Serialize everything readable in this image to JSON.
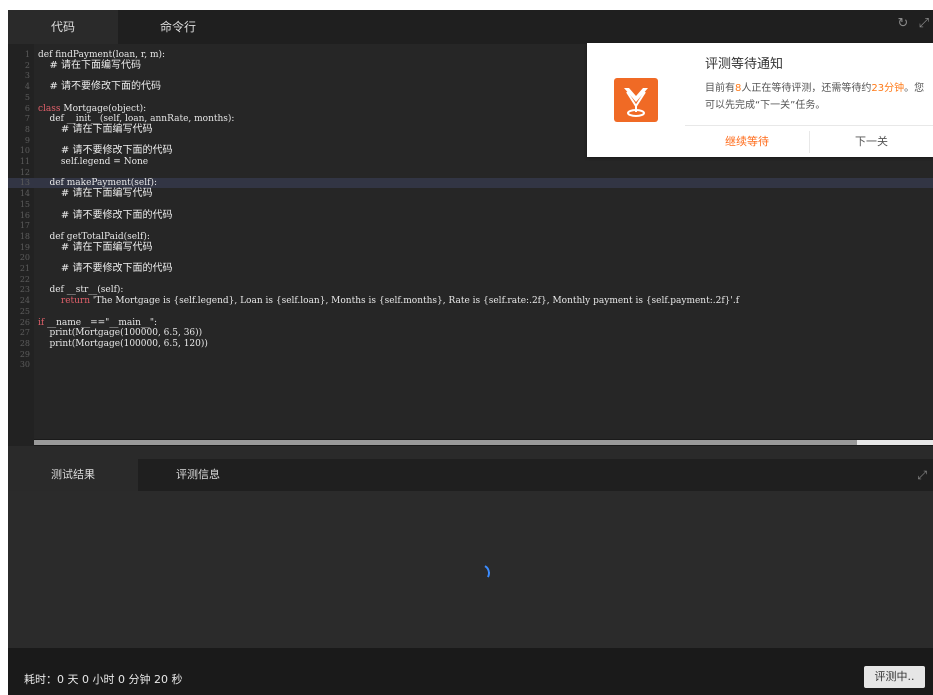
{
  "tabs": {
    "code": "代码",
    "command": "命令行"
  },
  "top_icons": {
    "reset": "↻",
    "expand": "⤢"
  },
  "code_lines": [
    {
      "num": "1",
      "parts": [
        {
          "t": "def findPayment(loan, r, m):"
        }
      ]
    },
    {
      "num": "2",
      "parts": [
        {
          "t": "    "
        },
        {
          "t": "# 请在下面编写代码",
          "c": "comment"
        }
      ]
    },
    {
      "num": "3",
      "parts": [
        {
          "t": ""
        }
      ]
    },
    {
      "num": "4",
      "parts": [
        {
          "t": "    "
        },
        {
          "t": "# 请不要修改下面的代码",
          "c": "comment"
        }
      ]
    },
    {
      "num": "5",
      "parts": [
        {
          "t": ""
        }
      ]
    },
    {
      "num": "6",
      "parts": [
        {
          "t": "class ",
          "c": "kw"
        },
        {
          "t": "Mortgage(object):"
        }
      ]
    },
    {
      "num": "7",
      "parts": [
        {
          "t": "    def __init__(self, loan, annRate, months):"
        }
      ]
    },
    {
      "num": "8",
      "parts": [
        {
          "t": "        "
        },
        {
          "t": "# 请在下面编写代码",
          "c": "comment"
        }
      ]
    },
    {
      "num": "9",
      "parts": [
        {
          "t": ""
        }
      ]
    },
    {
      "num": "10",
      "parts": [
        {
          "t": "        "
        },
        {
          "t": "# 请不要修改下面的代码",
          "c": "comment"
        }
      ]
    },
    {
      "num": "11",
      "parts": [
        {
          "t": "        self.legend = None"
        }
      ]
    },
    {
      "num": "12",
      "parts": [
        {
          "t": ""
        }
      ]
    },
    {
      "num": "13",
      "parts": [
        {
          "t": "    def makePayment(self):"
        }
      ]
    },
    {
      "num": "14",
      "parts": [
        {
          "t": "        "
        },
        {
          "t": "# 请在下面编写代码",
          "c": "comment"
        }
      ]
    },
    {
      "num": "15",
      "parts": [
        {
          "t": ""
        }
      ]
    },
    {
      "num": "16",
      "parts": [
        {
          "t": "        "
        },
        {
          "t": "# 请不要修改下面的代码",
          "c": "comment"
        }
      ]
    },
    {
      "num": "17",
      "parts": [
        {
          "t": ""
        }
      ]
    },
    {
      "num": "18",
      "parts": [
        {
          "t": "    def getTotalPaid(self):"
        }
      ]
    },
    {
      "num": "19",
      "parts": [
        {
          "t": "        "
        },
        {
          "t": "# 请在下面编写代码",
          "c": "comment"
        }
      ]
    },
    {
      "num": "20",
      "parts": [
        {
          "t": ""
        }
      ]
    },
    {
      "num": "21",
      "parts": [
        {
          "t": "        "
        },
        {
          "t": "# 请不要修改下面的代码",
          "c": "comment"
        }
      ]
    },
    {
      "num": "22",
      "parts": [
        {
          "t": ""
        }
      ]
    },
    {
      "num": "23",
      "parts": [
        {
          "t": "    def __str__(self):"
        }
      ]
    },
    {
      "num": "24",
      "parts": [
        {
          "t": "        "
        },
        {
          "t": "return ",
          "c": "kw"
        },
        {
          "t": "'The Mortgage is {self.legend}, Loan is {self.loan}, Months is {self.months}, Rate is {self.rate:.2f}, Monthly payment is {self.payment:.2f}'.f"
        }
      ]
    },
    {
      "num": "25",
      "parts": [
        {
          "t": ""
        }
      ]
    },
    {
      "num": "26",
      "parts": [
        {
          "t": "if ",
          "c": "kw"
        },
        {
          "t": "__name__==\"__main__\":"
        }
      ]
    },
    {
      "num": "27",
      "parts": [
        {
          "t": "    print(Mortgage(100000, 6.5, 36))"
        }
      ]
    },
    {
      "num": "28",
      "parts": [
        {
          "t": "    print(Mortgage(100000, 6.5, 120))"
        }
      ]
    },
    {
      "num": "29",
      "parts": [
        {
          "t": ""
        }
      ]
    },
    {
      "num": "30",
      "parts": [
        {
          "t": ""
        }
      ]
    }
  ],
  "highlighted_line": "13",
  "notice": {
    "title": "评测等待通知",
    "body_prefix": "目前有",
    "waiting_count": "8",
    "body_mid": "人正在等待评测，还需等待约",
    "wait_time": "23分钟",
    "body_suffix": "。您可以先完成“下一关”任务。",
    "continue_label": "继续等待",
    "next_label": "下一关"
  },
  "result_tabs": {
    "result": "测试结果",
    "info": "评测信息"
  },
  "footer": {
    "elapsed": "耗时：0 天 0 小时 0 分钟 20 秒",
    "judge_button": "评测中.."
  },
  "colors": {
    "accent": "#ff7a18",
    "keyword": "#e0606a",
    "spinner": "#3b8cff"
  }
}
